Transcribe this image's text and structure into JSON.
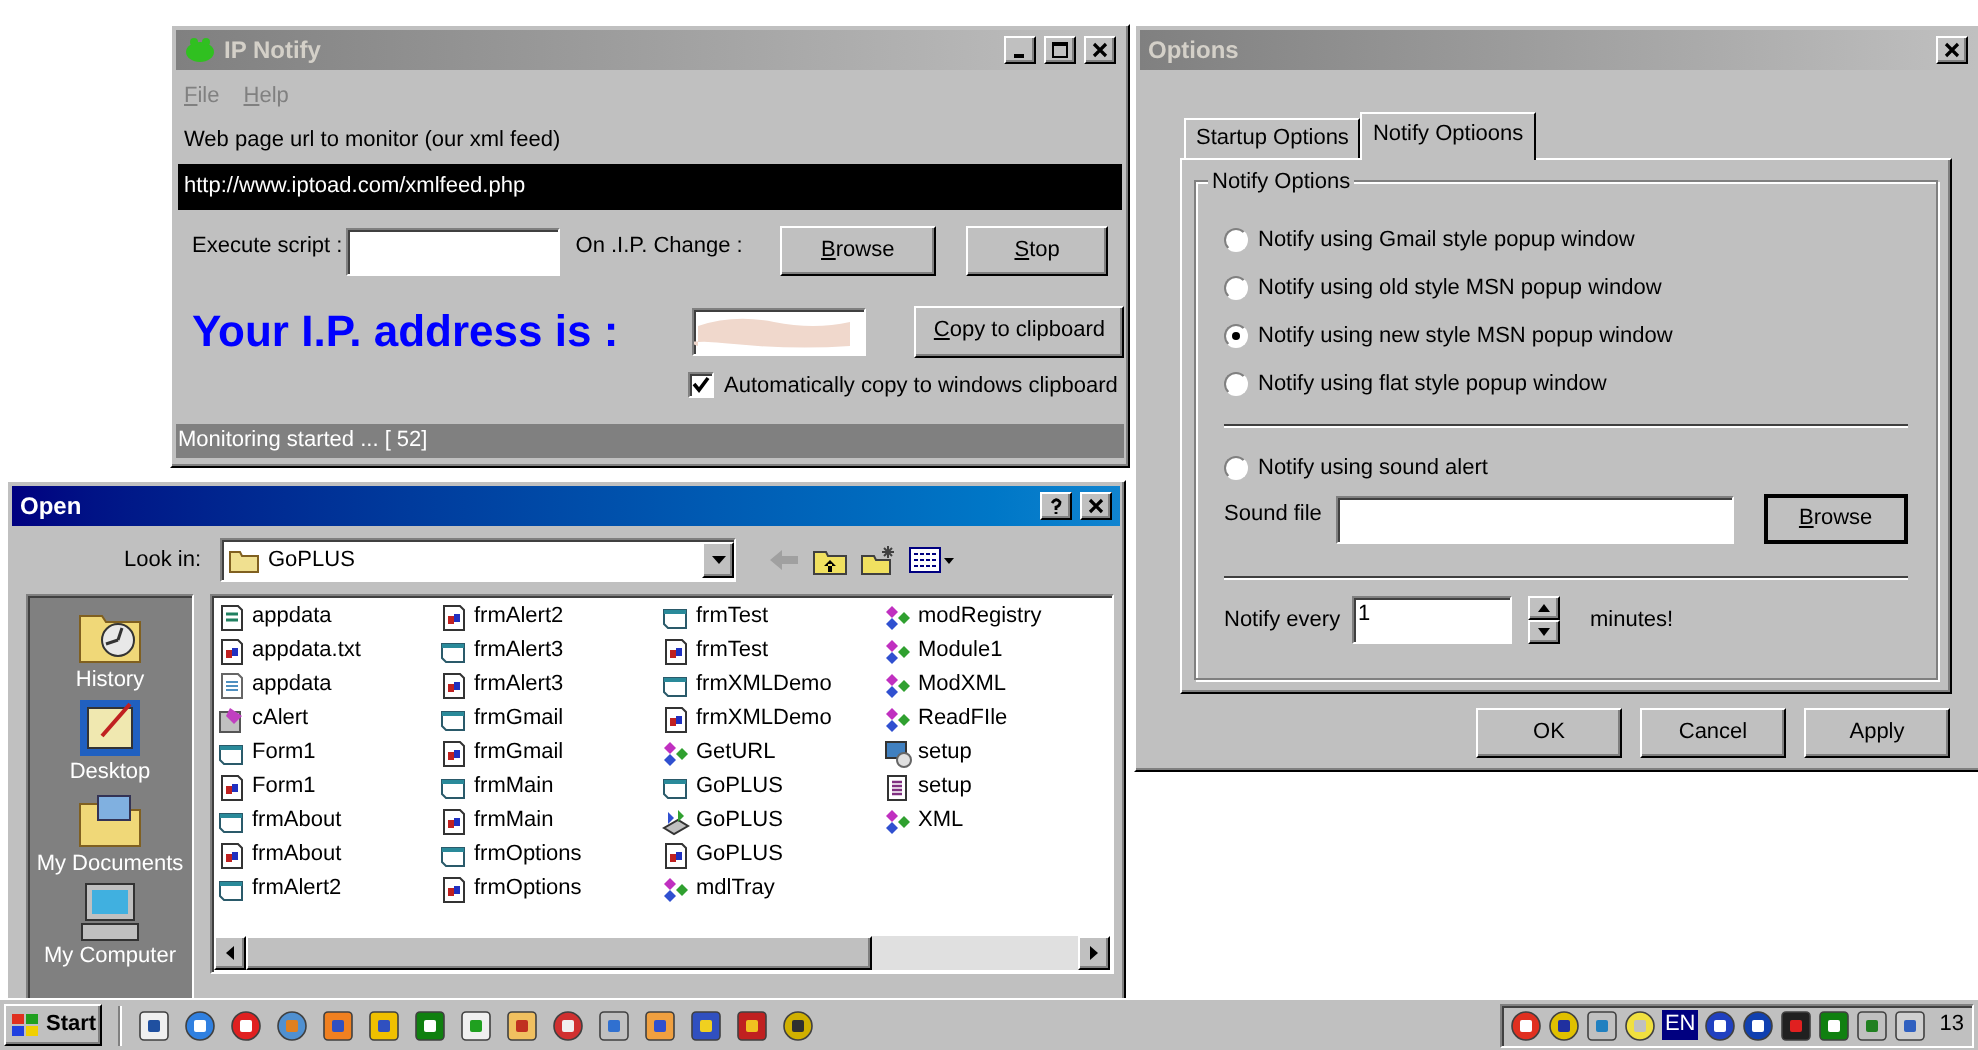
{
  "ip_notify": {
    "title": "IP Notify",
    "active": false,
    "menu": [
      "File",
      "Help"
    ],
    "url_label": "Web page url to monitor (our xml feed)",
    "url": "http://www.iptoad.com/xmlfeed.php",
    "script_label": "Execute script :",
    "on_change_label": "On .I.P. Change :",
    "browse_button": "Browse",
    "stop_button": "Stop",
    "ip_label": "Your I.P. address is :",
    "copy_button": "Copy to clipboard",
    "auto_copy": {
      "label": "Automatically copy to windows clipboard",
      "checked": true
    },
    "status": "Monitoring started ... [ 52]"
  },
  "open_dialog": {
    "title": "Open",
    "active": true,
    "look_in_label": "Look in:",
    "folder": "GoPLUS",
    "places": [
      {
        "label": "History",
        "kind": "history"
      },
      {
        "label": "Desktop",
        "kind": "desktop"
      },
      {
        "label": "My Documents",
        "kind": "documents"
      },
      {
        "label": "My Computer",
        "kind": "computer"
      }
    ],
    "files": [
      {
        "name": "appdata",
        "kind": "script"
      },
      {
        "name": "appdata.txt",
        "kind": "binary"
      },
      {
        "name": "appdata",
        "kind": "text"
      },
      {
        "name": "cAlert",
        "kind": "class"
      },
      {
        "name": "Form1",
        "kind": "form"
      },
      {
        "name": "Form1",
        "kind": "binary"
      },
      {
        "name": "frmAbout",
        "kind": "form"
      },
      {
        "name": "frmAbout",
        "kind": "binary"
      },
      {
        "name": "frmAlert2",
        "kind": "form"
      },
      {
        "name": "frmAlert2",
        "kind": "binary"
      },
      {
        "name": "frmAlert3",
        "kind": "form"
      },
      {
        "name": "frmAlert3",
        "kind": "binary"
      },
      {
        "name": "frmGmail",
        "kind": "form"
      },
      {
        "name": "frmGmail",
        "kind": "binary"
      },
      {
        "name": "frmMain",
        "kind": "form"
      },
      {
        "name": "frmMain",
        "kind": "binary"
      },
      {
        "name": "frmOptions",
        "kind": "form"
      },
      {
        "name": "frmOptions",
        "kind": "binary"
      },
      {
        "name": "frmTest",
        "kind": "form"
      },
      {
        "name": "frmTest",
        "kind": "binary"
      },
      {
        "name": "frmXMLDemo",
        "kind": "form"
      },
      {
        "name": "frmXMLDemo",
        "kind": "binary"
      },
      {
        "name": "GetURL",
        "kind": "module"
      },
      {
        "name": "GoPLUS",
        "kind": "form"
      },
      {
        "name": "GoPLUS",
        "kind": "project"
      },
      {
        "name": "GoPLUS",
        "kind": "binary"
      },
      {
        "name": "mdlTray",
        "kind": "module"
      },
      {
        "name": "modRegistry",
        "kind": "module"
      },
      {
        "name": "Module1",
        "kind": "module"
      },
      {
        "name": "ModXML",
        "kind": "module"
      },
      {
        "name": "ReadFIle",
        "kind": "module"
      },
      {
        "name": "setup",
        "kind": "setup"
      },
      {
        "name": "setup",
        "kind": "list"
      },
      {
        "name": "XML",
        "kind": "module"
      }
    ]
  },
  "options": {
    "title": "Options",
    "active": false,
    "tabs": [
      {
        "label": "Startup Options",
        "selected": false
      },
      {
        "label": "Notify Optioons",
        "selected": true
      }
    ],
    "group_label": "Notify Options",
    "popup_styles": [
      {
        "label": "Notify using Gmail style popup window",
        "selected": false
      },
      {
        "label": "Notify using old style MSN popup window",
        "selected": false
      },
      {
        "label": "Notify using new style MSN popup window",
        "selected": true
      },
      {
        "label": "Notify using flat style popup window",
        "selected": false
      }
    ],
    "sound_alert": {
      "label": "Notify using sound alert",
      "checked": false
    },
    "sound_file_label": "Sound file",
    "browse_button": "Browse",
    "notify_every_label": "Notify every",
    "notify_every_value": "1",
    "minutes_label": "minutes!",
    "buttons": [
      "OK",
      "Cancel",
      "Apply"
    ]
  },
  "taskbar": {
    "start": "Start",
    "language": "EN",
    "clock": "13"
  }
}
